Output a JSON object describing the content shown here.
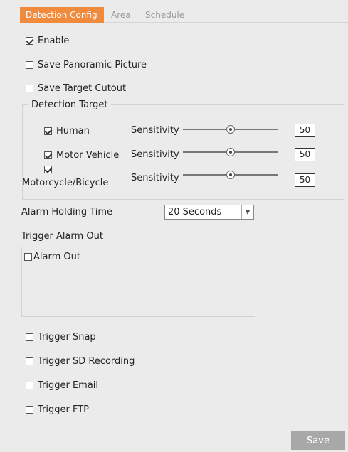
{
  "tabs": [
    {
      "label": "Detection Config",
      "active": true
    },
    {
      "label": "Area",
      "active": false
    },
    {
      "label": "Schedule",
      "active": false
    }
  ],
  "enable": {
    "label": "Enable",
    "checked": true
  },
  "save_panoramic": {
    "label": "Save Panoramic Picture",
    "checked": false
  },
  "save_target": {
    "label": "Save Target Cutout",
    "checked": false
  },
  "detection_target": {
    "legend": "Detection Target",
    "items": [
      {
        "label": "Human",
        "checked": true,
        "sensitivity_label": "Sensitivity",
        "sensitivity": 50
      },
      {
        "label": "Motor Vehicle",
        "checked": true,
        "sensitivity_label": "Sensitivity",
        "sensitivity": 50
      },
      {
        "label": "Motorcycle/Bicycle",
        "checked": true,
        "sensitivity_label": "Sensitivity",
        "sensitivity": 50
      }
    ]
  },
  "alarm_holding": {
    "label": "Alarm Holding Time",
    "value": "20 Seconds"
  },
  "trigger_alarm_out": {
    "label": "Trigger Alarm Out",
    "alarm_out_label": "Alarm Out",
    "alarm_out_checked": false
  },
  "triggers": [
    {
      "label": "Trigger Snap",
      "checked": false
    },
    {
      "label": "Trigger SD Recording",
      "checked": false
    },
    {
      "label": "Trigger Email",
      "checked": false
    },
    {
      "label": "Trigger FTP",
      "checked": false
    }
  ],
  "save_button": "Save",
  "colors": {
    "accent": "#f08a3c",
    "save_bg": "#a8a8a8",
    "background": "#ebebeb"
  }
}
